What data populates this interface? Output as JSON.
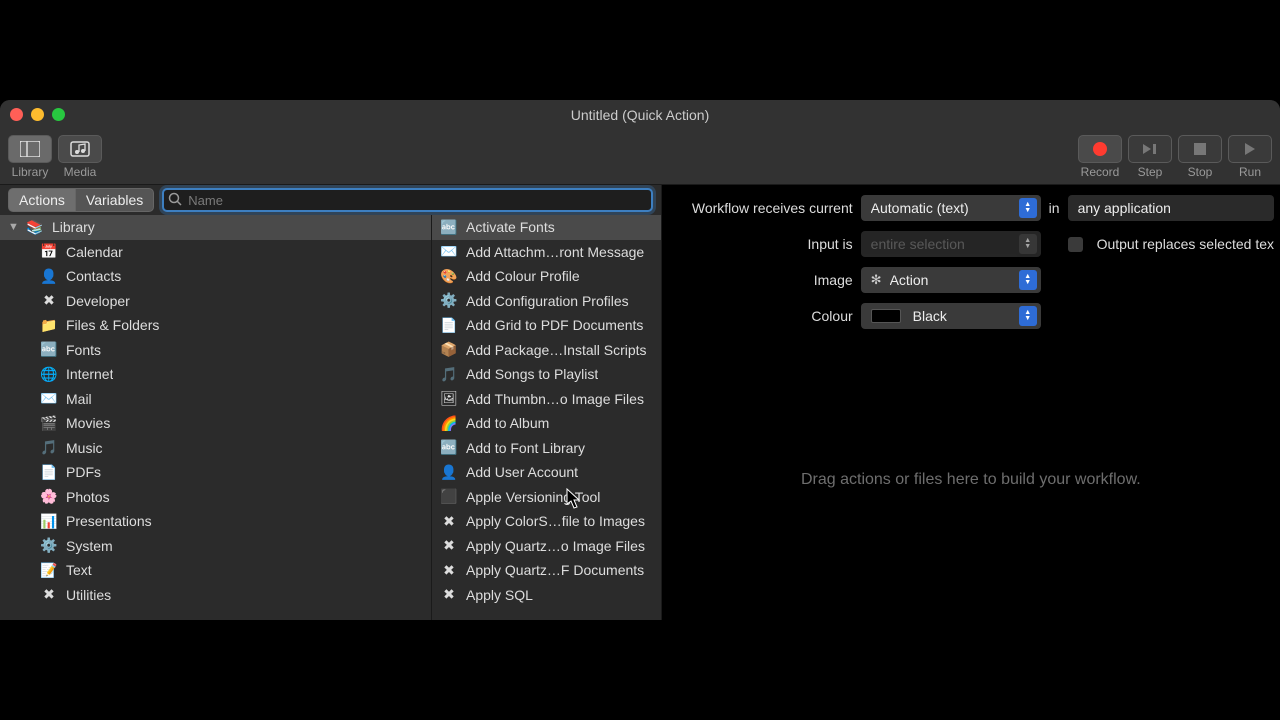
{
  "window": {
    "title": "Untitled (Quick Action)"
  },
  "toolbar": {
    "library": "Library",
    "media": "Media",
    "record": "Record",
    "step": "Step",
    "stop": "Stop",
    "run": "Run"
  },
  "tabs": {
    "actions": "Actions",
    "variables": "Variables"
  },
  "search": {
    "placeholder": "Name",
    "value": ""
  },
  "library": {
    "root": "Library",
    "items": [
      {
        "icon": "📅",
        "label": "Calendar"
      },
      {
        "icon": "👤",
        "label": "Contacts"
      },
      {
        "icon": "✖︎",
        "label": "Developer"
      },
      {
        "icon": "📁",
        "label": "Files & Folders"
      },
      {
        "icon": "🔤",
        "label": "Fonts"
      },
      {
        "icon": "🌐",
        "label": "Internet"
      },
      {
        "icon": "✉️",
        "label": "Mail"
      },
      {
        "icon": "🎬",
        "label": "Movies"
      },
      {
        "icon": "🎵",
        "label": "Music"
      },
      {
        "icon": "📄",
        "label": "PDFs"
      },
      {
        "icon": "🌸",
        "label": "Photos"
      },
      {
        "icon": "📊",
        "label": "Presentations"
      },
      {
        "icon": "⚙️",
        "label": "System"
      },
      {
        "icon": "📝",
        "label": "Text"
      },
      {
        "icon": "✖︎",
        "label": "Utilities"
      }
    ]
  },
  "actions": [
    {
      "icon": "🔤",
      "label": "Activate Fonts",
      "selected": true
    },
    {
      "icon": "✉️",
      "label": "Add Attachm…ront Message"
    },
    {
      "icon": "🎨",
      "label": "Add Colour Profile"
    },
    {
      "icon": "⚙️",
      "label": "Add Configuration Profiles"
    },
    {
      "icon": "📄",
      "label": "Add Grid to PDF Documents"
    },
    {
      "icon": "📦",
      "label": "Add Package…Install Scripts"
    },
    {
      "icon": "🎵",
      "label": "Add Songs to Playlist"
    },
    {
      "icon": "🖼",
      "label": "Add Thumbn…o Image Files"
    },
    {
      "icon": "🌈",
      "label": "Add to Album"
    },
    {
      "icon": "🔤",
      "label": "Add to Font Library"
    },
    {
      "icon": "👤",
      "label": "Add User Account"
    },
    {
      "icon": "⬛",
      "label": "Apple Versioning Tool"
    },
    {
      "icon": "✖︎",
      "label": "Apply ColorS…file to Images"
    },
    {
      "icon": "✖︎",
      "label": "Apply Quartz…o Image Files"
    },
    {
      "icon": "✖︎",
      "label": "Apply Quartz…F Documents"
    },
    {
      "icon": "✖︎",
      "label": "Apply SQL"
    }
  ],
  "inspector": {
    "receives_label": "Workflow receives current",
    "receives_value": "Automatic (text)",
    "in_label": "in",
    "in_value": "any application",
    "input_label": "Input is",
    "input_value": "entire selection",
    "output_replaces": "Output replaces selected tex",
    "image_label": "Image",
    "image_value": "Action",
    "colour_label": "Colour",
    "colour_value": "Black"
  },
  "dropzone": "Drag actions or files here to build your workflow."
}
